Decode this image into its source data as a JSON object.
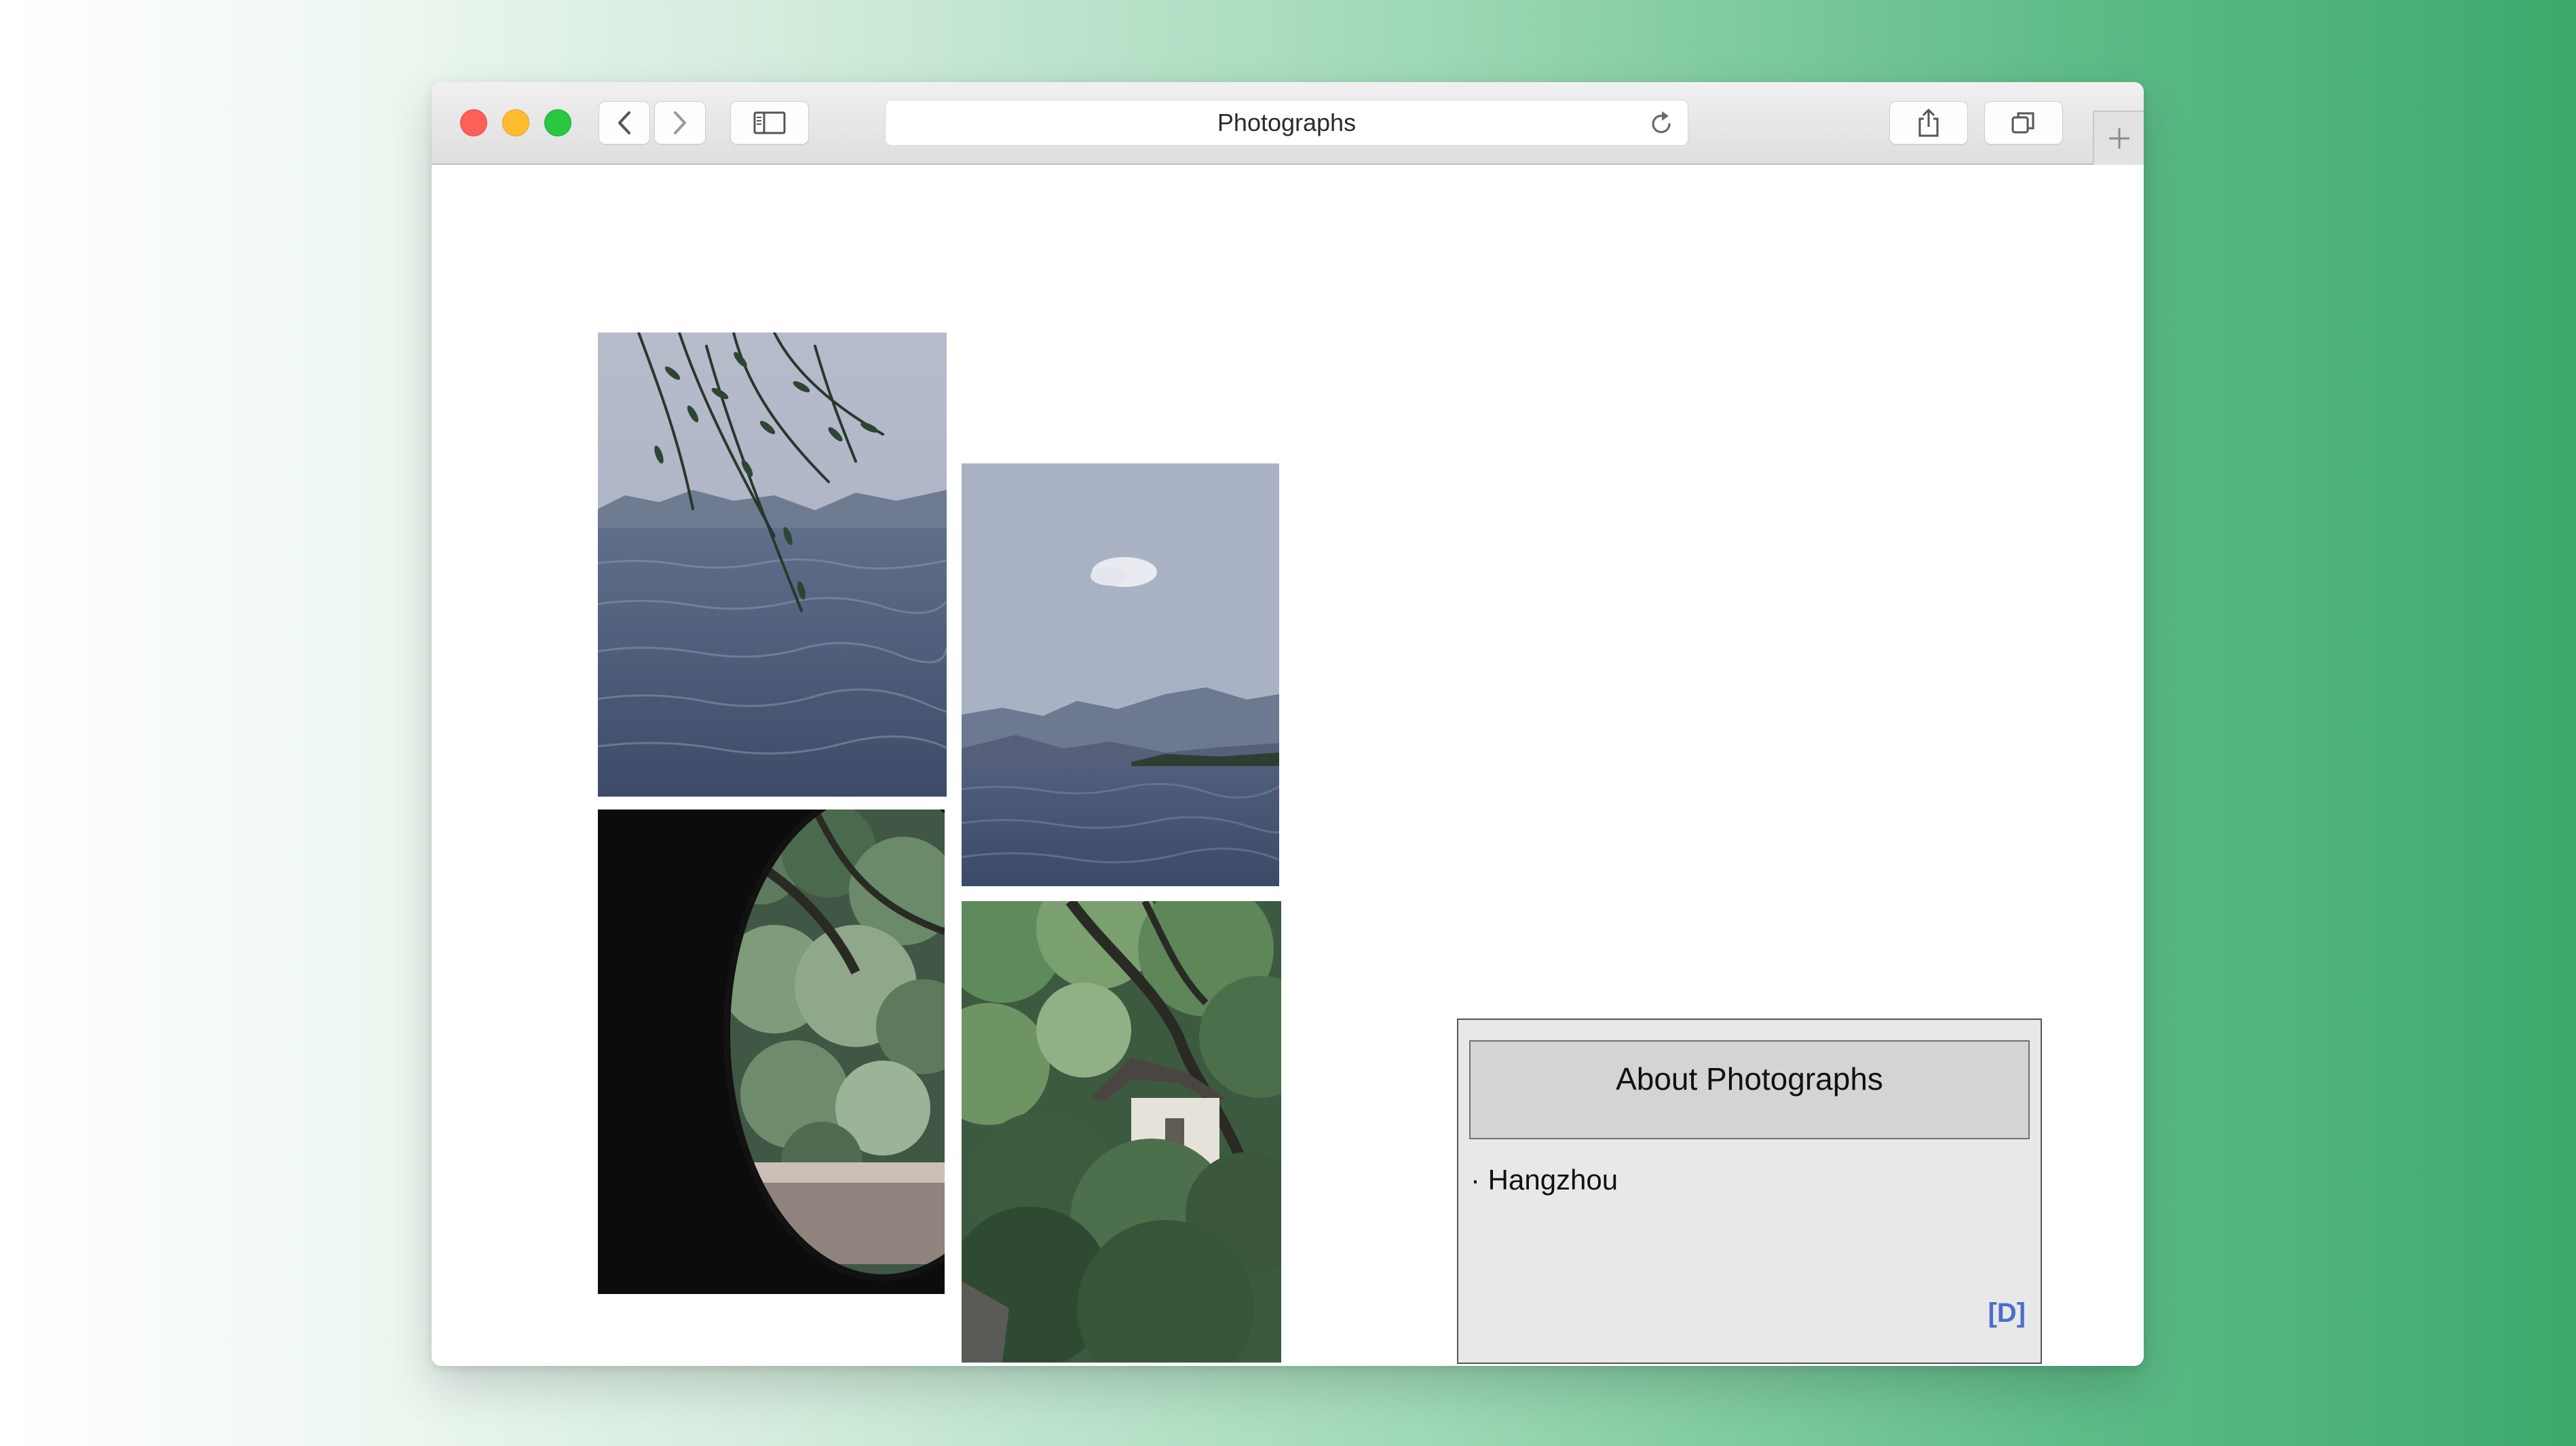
{
  "browser": {
    "address_title": "Photographs",
    "icons": [
      "back-icon",
      "forward-icon",
      "sidebar-icon",
      "reload-icon",
      "share-icon",
      "tabs-icon",
      "plus-icon"
    ]
  },
  "gallery": {
    "photos": [
      {
        "subject": "lake with willow branches and mountains"
      },
      {
        "subject": "lake, distant mountains and small cloud"
      },
      {
        "subject": "moon gate opening onto garden greenery"
      },
      {
        "subject": "traditional pavilion among trees"
      }
    ]
  },
  "about": {
    "title": "About Photographs",
    "item": "· Hangzhou",
    "link": "[D]"
  },
  "colors": {
    "link": "#4a6fc9",
    "panel_bg": "#e8e8e8",
    "header_bg": "#d4d4d4",
    "backdrop_end": "#3daa6c"
  }
}
